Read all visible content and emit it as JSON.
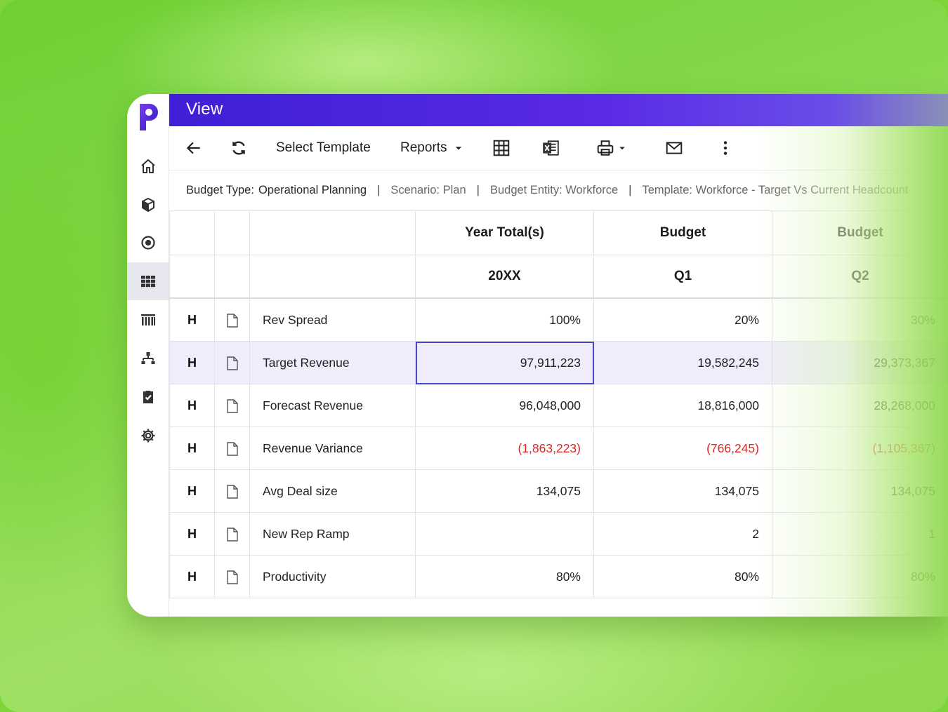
{
  "window": {
    "title": "View"
  },
  "toolbar": {
    "select_template_label": "Select Template",
    "reports_label": "Reports"
  },
  "info": {
    "budget_type_key": "Budget Type:",
    "budget_type_value": "Operational Planning",
    "scenario": "Scenario:  Plan",
    "budget_entity": "Budget Entity: Workforce",
    "template": "Template: Workforce - Target Vs Current Headcount",
    "separator": "|"
  },
  "table": {
    "header_row1": [
      "Year Total(s)",
      "Budget",
      "Budget"
    ],
    "header_row2": [
      "20XX",
      "Q1",
      "Q2"
    ],
    "rows": [
      {
        "flag": "H",
        "label": "Rev Spread",
        "values": [
          "100%",
          "20%",
          "30%"
        ]
      },
      {
        "flag": "H",
        "label": "Target Revenue",
        "values": [
          "97,911,223",
          "19,582,245",
          "29,373,367"
        ]
      },
      {
        "flag": "H",
        "label": "Forecast Revenue",
        "values": [
          "96,048,000",
          "18,816,000",
          "28,268,000"
        ]
      },
      {
        "flag": "H",
        "label": "Revenue Variance",
        "values": [
          "(1,863,223)",
          "(766,245)",
          "(1,105,367)"
        ]
      },
      {
        "flag": "H",
        "label": "Avg Deal size",
        "values": [
          "134,075",
          "134,075",
          "134,075"
        ]
      },
      {
        "flag": "H",
        "label": "New Rep Ramp",
        "values": [
          "",
          "2",
          "1"
        ]
      },
      {
        "flag": "H",
        "label": "Productivity",
        "values": [
          "80%",
          "80%",
          "80%"
        ]
      }
    ]
  },
  "icons": {
    "sidebar": [
      "home-icon",
      "cube-icon",
      "target-icon",
      "grid-icon",
      "buildings-icon",
      "hierarchy-icon",
      "clipboard-check-icon",
      "gear-icon"
    ],
    "toolbar": [
      "back-arrow-icon",
      "refresh-icon",
      "caret-down-icon",
      "table-icon",
      "excel-icon",
      "printer-icon",
      "mail-icon",
      "more-vertical-icon"
    ]
  },
  "colors": {
    "brand_purple": "#4a2ae0",
    "negative_red": "#e02424",
    "selected_row": "#efedfb",
    "focus_border": "#4a44c7"
  }
}
